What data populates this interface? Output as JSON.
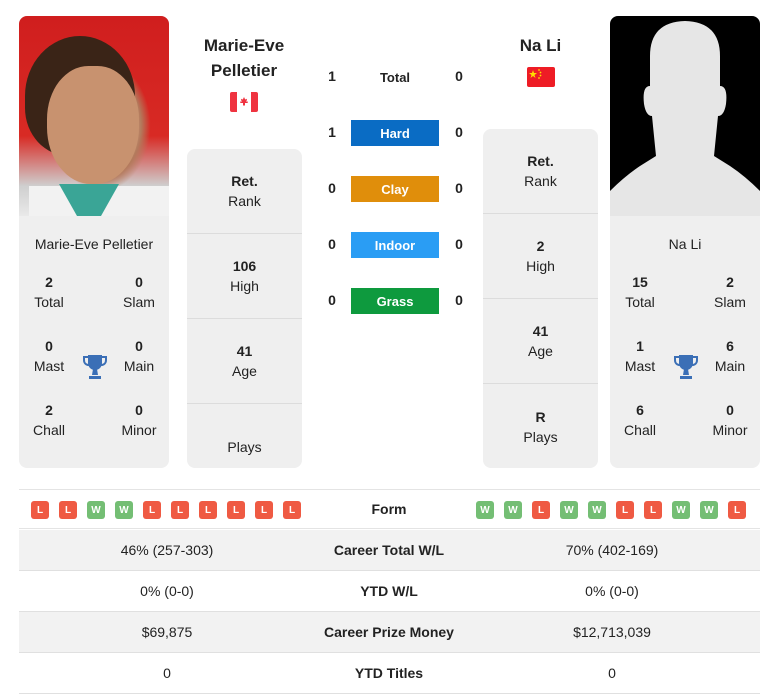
{
  "player1": {
    "name_line1": "Marie-Eve",
    "name_line2": "Pelletier",
    "card_name": "Marie-Eve Pelletier",
    "flag": "canada-flag",
    "titles": {
      "total": {
        "value": "2",
        "label": "Total"
      },
      "slam": {
        "value": "0",
        "label": "Slam"
      },
      "mast": {
        "value": "0",
        "label": "Mast"
      },
      "main": {
        "value": "0",
        "label": "Main"
      },
      "chall": {
        "value": "2",
        "label": "Chall"
      },
      "minor": {
        "value": "0",
        "label": "Minor"
      }
    },
    "info": {
      "rank": {
        "value": "Ret.",
        "label": "Rank"
      },
      "high": {
        "value": "106",
        "label": "High"
      },
      "age": {
        "value": "41",
        "label": "Age"
      },
      "plays": {
        "value": "",
        "label": "Plays"
      }
    },
    "form": [
      "L",
      "L",
      "W",
      "W",
      "L",
      "L",
      "L",
      "L",
      "L",
      "L"
    ]
  },
  "player2": {
    "name": "Na Li",
    "card_name": "Na Li",
    "flag": "china-flag",
    "titles": {
      "total": {
        "value": "15",
        "label": "Total"
      },
      "slam": {
        "value": "2",
        "label": "Slam"
      },
      "mast": {
        "value": "1",
        "label": "Mast"
      },
      "main": {
        "value": "6",
        "label": "Main"
      },
      "chall": {
        "value": "6",
        "label": "Chall"
      },
      "minor": {
        "value": "0",
        "label": "Minor"
      }
    },
    "info": {
      "rank": {
        "value": "Ret.",
        "label": "Rank"
      },
      "high": {
        "value": "2",
        "label": "High"
      },
      "age": {
        "value": "41",
        "label": "Age"
      },
      "plays": {
        "value": "R",
        "label": "Plays"
      }
    },
    "form": [
      "W",
      "W",
      "L",
      "W",
      "W",
      "L",
      "L",
      "W",
      "W",
      "L"
    ]
  },
  "h2h": [
    {
      "label": "Total",
      "p1": "1",
      "p2": "0",
      "color": ""
    },
    {
      "label": "Hard",
      "p1": "1",
      "p2": "0",
      "color": "#0a6cc4"
    },
    {
      "label": "Clay",
      "p1": "0",
      "p2": "0",
      "color": "#e08e0b"
    },
    {
      "label": "Indoor",
      "p1": "0",
      "p2": "0",
      "color": "#2a9df4"
    },
    {
      "label": "Grass",
      "p1": "0",
      "p2": "0",
      "color": "#0e9a3e"
    }
  ],
  "form_label": "Form",
  "stats": [
    {
      "label": "Career Total W/L",
      "p1": "46% (257-303)",
      "p2": "70% (402-169)"
    },
    {
      "label": "YTD W/L",
      "p1": "0% (0-0)",
      "p2": "0% (0-0)"
    },
    {
      "label": "Career Prize Money",
      "p1": "$69,875",
      "p2": "$12,713,039"
    },
    {
      "label": "YTD Titles",
      "p1": "0",
      "p2": "0"
    }
  ],
  "colors": {
    "win": "#74be74",
    "loss": "#ef5a43",
    "trophy": "#3b6fb6",
    "card_bg": "#efefef"
  }
}
